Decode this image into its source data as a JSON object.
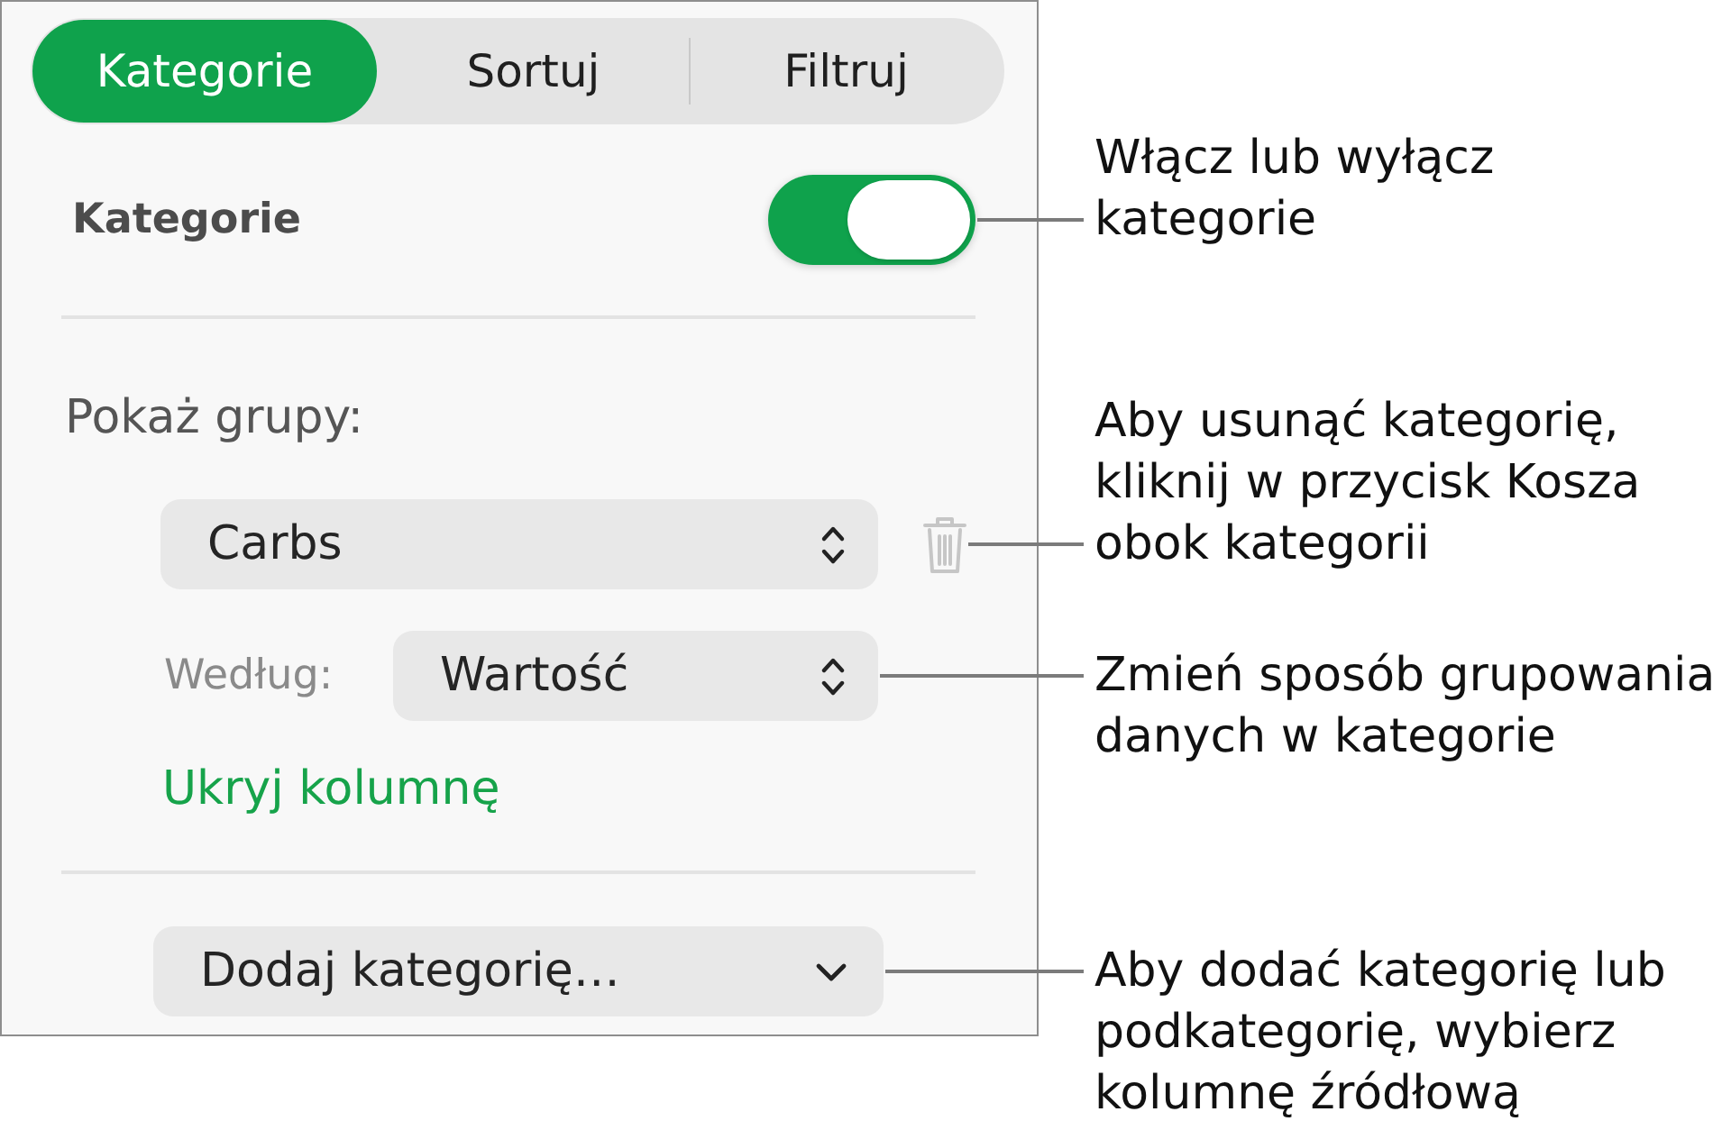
{
  "tabs": [
    {
      "label": "Kategorie",
      "selected": true
    },
    {
      "label": "Sortuj",
      "selected": false
    },
    {
      "label": "Filtruj",
      "selected": false
    }
  ],
  "categories": {
    "label": "Kategorie",
    "on": true
  },
  "groups": {
    "heading": "Pokaż grupy:",
    "column": {
      "value": "Carbs"
    },
    "by": {
      "label": "Według:",
      "value": "Wartość"
    },
    "link": "Ukryj kolumnę"
  },
  "add_category": {
    "value": "Dodaj kategorię…"
  },
  "callouts": [
    "Włącz lub wyłącz\nkategorie",
    "Aby usunąć kategorię,\nkliknij w przycisk Kosza\nobok kategorii",
    "Zmień sposób grupowania\ndanych w kategorie",
    "Aby dodać kategorię lub\npodkategorię, wybierz\nkolumnę źródłową"
  ]
}
